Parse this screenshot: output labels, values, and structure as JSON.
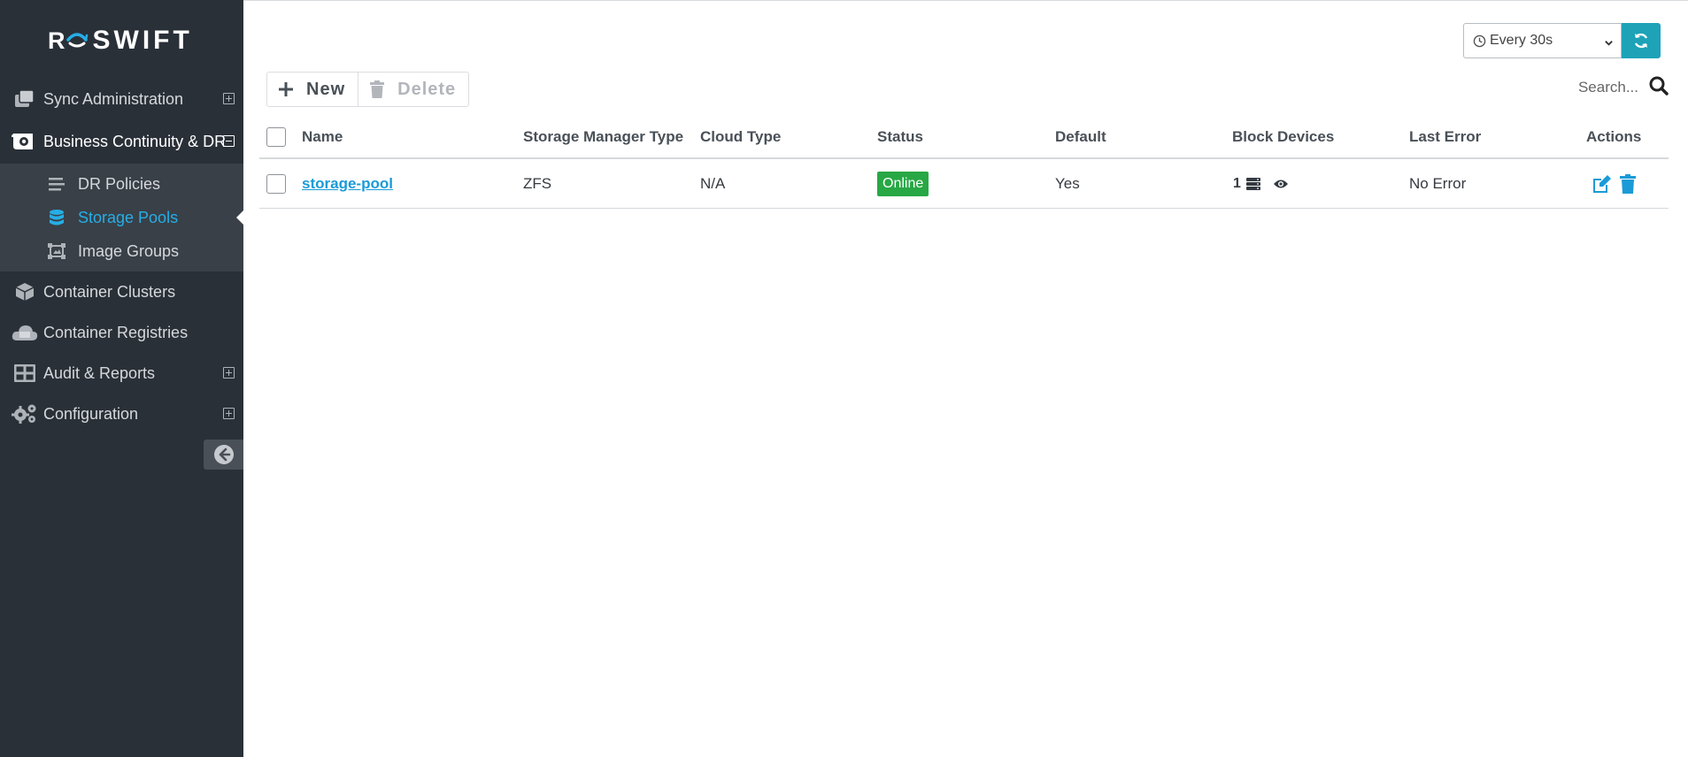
{
  "app": {
    "logo_r": "R",
    "logo_name": "SWIFT"
  },
  "sidebar": {
    "items": [
      {
        "label": "Sync Administration",
        "icon": "copy-icon",
        "expand": "plus"
      },
      {
        "label": "Business Continuity & DR",
        "icon": "dr-gear-icon",
        "expand": "minus"
      },
      {
        "label": "Container Clusters",
        "icon": "cube-icon"
      },
      {
        "label": "Container Registries",
        "icon": "cloud-icon"
      },
      {
        "label": "Audit & Reports",
        "icon": "table-icon",
        "expand": "plus"
      },
      {
        "label": "Configuration",
        "icon": "gears-icon",
        "expand": "plus"
      }
    ],
    "subitems": [
      {
        "label": "DR Policies",
        "icon": "list-icon"
      },
      {
        "label": "Storage Pools",
        "icon": "database-icon",
        "current": true
      },
      {
        "label": "Image Groups",
        "icon": "image-group-icon"
      }
    ]
  },
  "header": {
    "refresh_interval": "Every 30s",
    "search_placeholder": "Search..."
  },
  "toolbar": {
    "new_label": "New",
    "delete_label": "Delete"
  },
  "table": {
    "columns": [
      "Name",
      "Storage Manager Type",
      "Cloud Type",
      "Status",
      "Default",
      "Block Devices",
      "Last Error",
      "Actions"
    ],
    "rows": [
      {
        "name": "storage-pool",
        "storage_manager_type": "ZFS",
        "cloud_type": "N/A",
        "status": "Online",
        "default": "Yes",
        "block_devices": "1",
        "last_error": "No Error"
      }
    ]
  },
  "colors": {
    "sidebar_bg": "#2a3038",
    "accent": "#26aee6",
    "status_online": "#28a745",
    "refresh_button": "#1ea2b8"
  }
}
